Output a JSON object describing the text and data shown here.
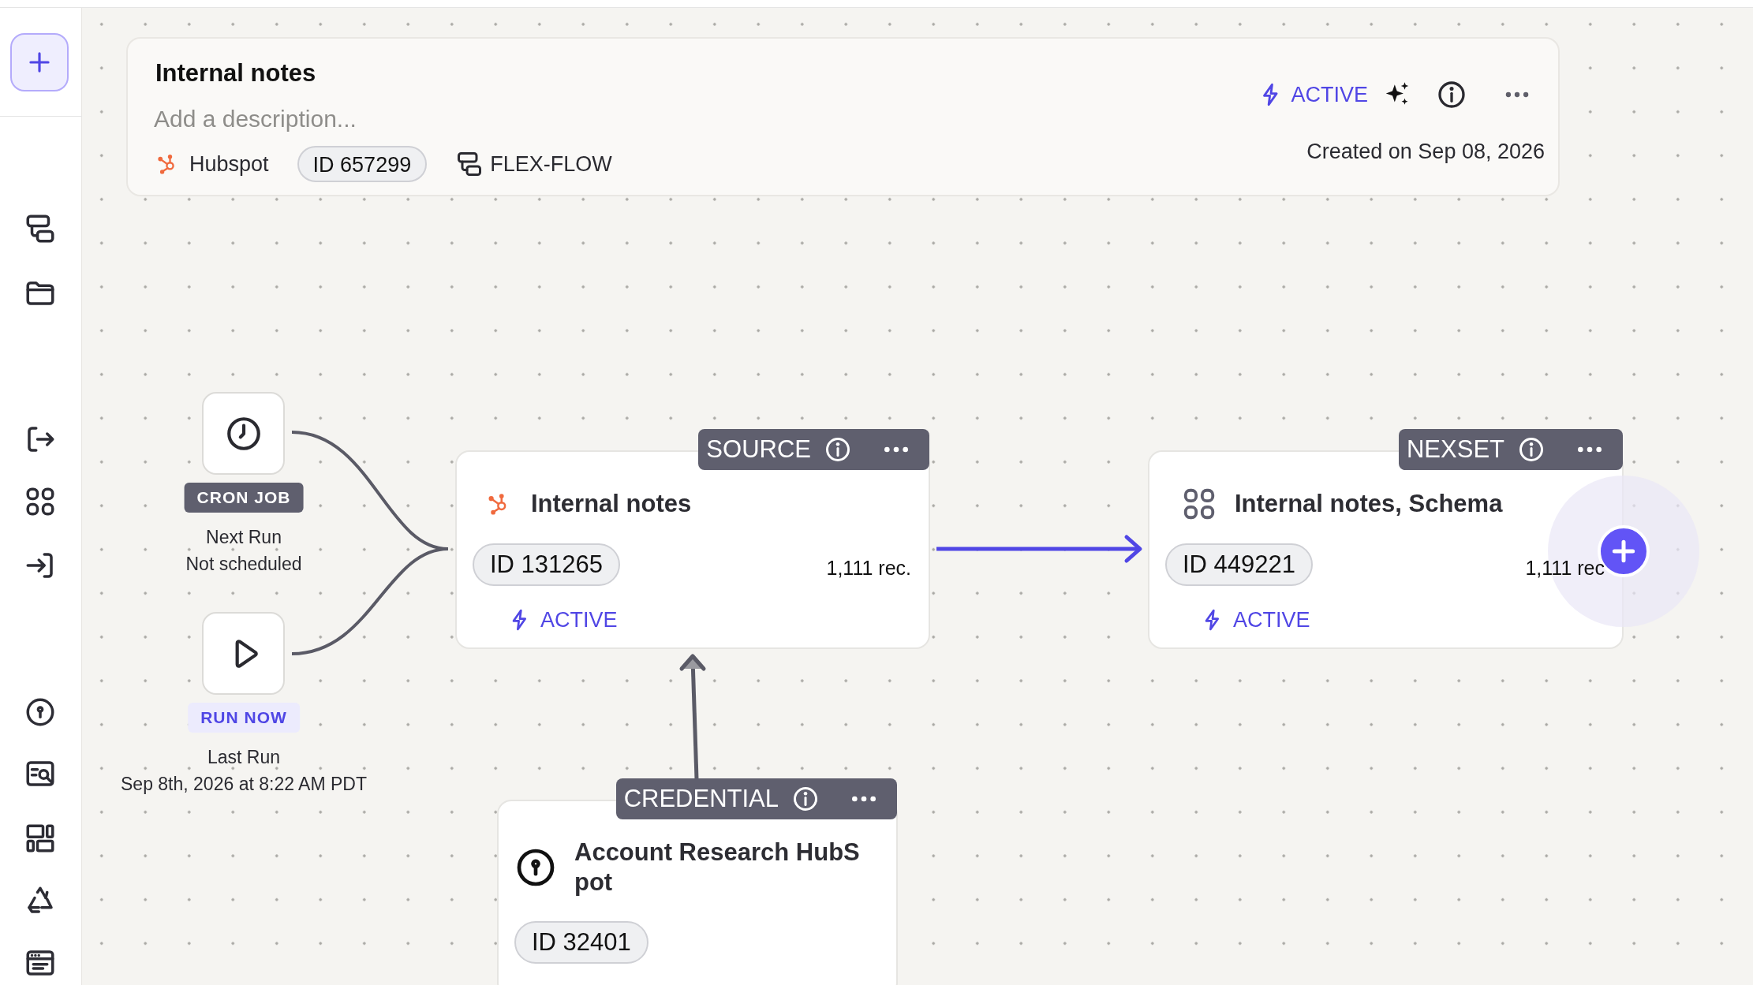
{
  "header": {
    "title": "Internal notes",
    "placeholder": "Add a description...",
    "source": "Hubspot",
    "id": "ID 657299",
    "flow_type": "FLEX-FLOW",
    "status": "ACTIVE",
    "created": "Created on Sep 08, 2026"
  },
  "triggers": [
    {
      "kind": "cron",
      "label": "CRON JOB",
      "line_1": "Next Run",
      "line_2": "Not scheduled"
    },
    {
      "kind": "run",
      "label": "RUN NOW",
      "line_1": "Last Run",
      "line_2": "Sep 8th, 2026 at 8:22 AM PDT"
    }
  ],
  "nodes": [
    {
      "kind": "source",
      "tag": "SOURCE",
      "title": "Internal notes",
      "id": "ID 131265",
      "records": "1,111 rec.",
      "status": "ACTIVE"
    },
    {
      "kind": "nexset",
      "tag": "NEXSET",
      "title": "Internal notes, Schema",
      "id": "ID 449221",
      "records": "1,111 rec",
      "status": "ACTIVE"
    },
    {
      "kind": "credential",
      "tag": "CREDENTIAL",
      "title": "Account Research HubSpot",
      "id": "ID 32401"
    }
  ]
}
